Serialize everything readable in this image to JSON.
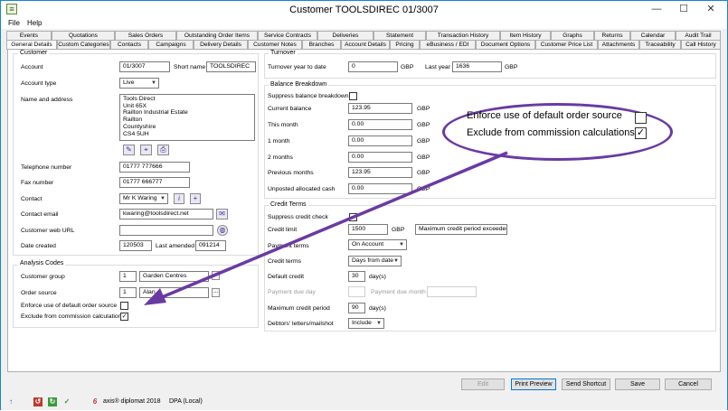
{
  "window": {
    "title": "Customer TOOLSDIREC 01/3007",
    "app_icon": "ledger-icon",
    "min": "—",
    "max": "☐",
    "close": "✕"
  },
  "menu": [
    "File",
    "Help"
  ],
  "tabs_row1": [
    "Events",
    "Quotations",
    "Sales Orders",
    "Outstanding Order Items",
    "Service Contracts",
    "Deliveries",
    "Statement",
    "Transaction History",
    "Item History",
    "Graphs",
    "Returns",
    "Calendar",
    "Audit Trail"
  ],
  "tabs_row2": [
    "General Details",
    "Custom Categories",
    "Contacts",
    "Campaigns",
    "Delivery Details",
    "Customer Notes",
    "Branches",
    "Account Details",
    "Pricing",
    "eBusiness / EDI",
    "Document Options",
    "Customer Price List",
    "Attachments",
    "Traceability",
    "Call History"
  ],
  "active_tab": "General Details",
  "customer": {
    "group_title": "Customer",
    "account_label": "Account",
    "account_value": "01/3007",
    "short_name_label": "Short name",
    "short_name_value": "TOOLSDIREC",
    "account_type_label": "Account type",
    "account_type_value": "Live",
    "name_address_label": "Name and address",
    "address_lines": [
      "Tools Direct",
      "Unit 65X",
      "Railton Industrial Estate",
      "Railton",
      "Countyshire",
      "CS4 5UH"
    ],
    "telephone_label": "Telephone number",
    "telephone_value": "01777 777666",
    "fax_label": "Fax number",
    "fax_value": "01777 666777",
    "contact_label": "Contact",
    "contact_value": "Mr K Waring",
    "email_label": "Contact email",
    "email_value": "kwaring@toolsdirect.net",
    "web_label": "Customer web URL",
    "web_value": "",
    "created_label": "Date created",
    "created_value": "120503",
    "amended_label": "Last amended",
    "amended_value": "091214"
  },
  "analysis": {
    "group_title": "Analysis Codes",
    "group_label": "Customer group",
    "group_code": "1",
    "group_name": "Garden Centres",
    "source_label": "Order source",
    "source_code": "1",
    "source_name": "Alan",
    "enforce_label": "Enforce use of default order source",
    "enforce_checked": "",
    "exclude_label": "Exclude from commission calculations",
    "exclude_checked": "✓"
  },
  "turnover": {
    "group_title": "Turnover",
    "ytd_label": "Turnover year to date",
    "ytd_value": "0",
    "ytd_currency": "GBP",
    "last_year_label": "Last year",
    "last_year_value": "1636",
    "last_year_currency": "GBP"
  },
  "balance": {
    "group_title": "Balance Breakdown",
    "suppress_label": "Suppress balance breakdown",
    "rows": [
      {
        "label": "Current balance",
        "value": "123.95",
        "currency": "GBP"
      },
      {
        "label": "This month",
        "value": "0.00",
        "currency": "GBP"
      },
      {
        "label": "1 month",
        "value": "0.00",
        "currency": "GBP"
      },
      {
        "label": "2 months",
        "value": "0.00",
        "currency": "GBP"
      },
      {
        "label": "Previous months",
        "value": "123.95",
        "currency": "GBP"
      },
      {
        "label": "Unposted allocated cash",
        "value": "0.00",
        "currency": "GBP"
      }
    ]
  },
  "credit": {
    "group_title": "Credit Terms",
    "suppress_label": "Suppress credit check",
    "limit_label": "Credit limit",
    "limit_value": "1500",
    "limit_currency": "GBP",
    "limit_action": "Maximum credit period exceeded",
    "payment_label": "Payment terms",
    "payment_value": "On Account",
    "terms_label": "Credit terms",
    "terms_value": "Days from date",
    "default_label": "Default credit",
    "default_value": "30",
    "default_unit": "day(s)",
    "due_day_label": "Payment due day",
    "due_month_label": "Payment due month",
    "max_label": "Maximum credit period",
    "max_value": "90",
    "max_unit": "day(s)",
    "debtors_label": "Debtors' letters/mailshot",
    "debtors_value": "Include"
  },
  "callout": {
    "enforce_label": "Enforce use of default order source",
    "exclude_label": "Exclude from commission calculations",
    "exclude_checked": "✓"
  },
  "buttons": {
    "edit": "Edit",
    "print": "Print Preview",
    "shortcut": "Send Shortcut",
    "save": "Save",
    "cancel": "Cancel"
  },
  "status": {
    "app": "axis® diplomat 2018",
    "db": "DPA (Local)"
  },
  "colors": {
    "accent": "#6a3aa3",
    "border": "#1883d7"
  }
}
